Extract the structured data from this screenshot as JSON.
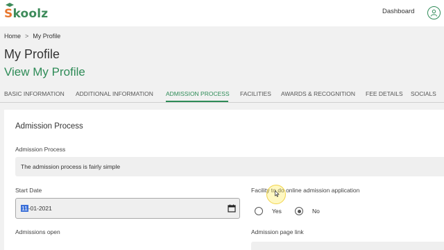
{
  "brand": {
    "logo_text_first": "S",
    "logo_text_rest": "koolz",
    "colors": {
      "orange": "#e8772e",
      "green": "#3d8b5a",
      "accent": "#2e8b57"
    }
  },
  "header": {
    "dashboard_label": "Dashboard",
    "user_icon": "user-icon"
  },
  "breadcrumb": {
    "home": "Home",
    "separator": ">",
    "current": "My Profile"
  },
  "page": {
    "title": "My Profile",
    "subtitle": "View My Profile"
  },
  "tabs": [
    {
      "label": "BASIC INFORMATION",
      "active": false
    },
    {
      "label": "ADDITIONAL INFORMATION",
      "active": false
    },
    {
      "label": "ADMISSION PROCESS",
      "active": true
    },
    {
      "label": "FACILITIES",
      "active": false
    },
    {
      "label": "AWARDS & RECOGNITION",
      "active": false
    },
    {
      "label": "FEE DETAILS",
      "active": false
    },
    {
      "label": "SOCIALS",
      "active": false
    }
  ],
  "card": {
    "title": "Admission Process",
    "admission_process": {
      "label": "Admission Process",
      "value": "The admission process is fairly simple"
    },
    "start_date": {
      "label": "Start Date",
      "value_selected": "11",
      "value_rest": "-01-2021",
      "icon": "calendar-icon"
    },
    "facility": {
      "label": "Facility to do online admission application",
      "options": [
        "Yes",
        "No"
      ],
      "selected": "No"
    },
    "admissions_open": {
      "label": "Admissions open"
    },
    "page_link": {
      "label": "Admission page link"
    }
  }
}
